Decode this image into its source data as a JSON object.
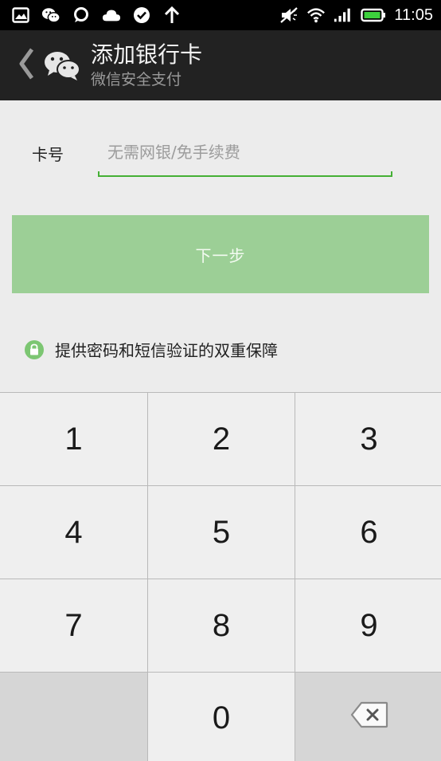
{
  "status_bar": {
    "time": "11:05",
    "left_icons": [
      "gallery-icon",
      "wechat-notification-icon",
      "chat-bubble-icon",
      "cloud-icon",
      "check-circle-icon",
      "upload-arrow-icon"
    ],
    "right_icons": [
      "mute-icon",
      "wifi-icon",
      "signal-icon",
      "battery-icon"
    ]
  },
  "header": {
    "title": "添加银行卡",
    "subtitle": "微信安全支付"
  },
  "form": {
    "card_label": "卡号",
    "card_placeholder": "无需网银/免手续费",
    "card_value": "",
    "next_button": "下一步",
    "security_note": "提供密码和短信验证的双重保障"
  },
  "colors": {
    "accent_green": "#45b035",
    "button_green_disabled": "#9ccf96",
    "header_bg": "#222222"
  },
  "keypad": {
    "keys": [
      "1",
      "2",
      "3",
      "4",
      "5",
      "6",
      "7",
      "8",
      "9",
      "",
      "0",
      "backspace"
    ]
  }
}
